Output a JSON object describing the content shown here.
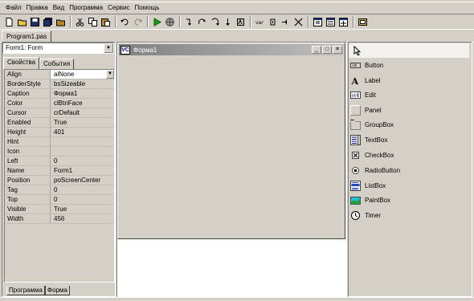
{
  "menu": [
    "Файл",
    "Правка",
    "Вид",
    "Программа",
    "Сервис",
    "Помощь"
  ],
  "toolbar": {
    "icons": [
      "new-file-icon",
      "open-icon",
      "save-icon",
      "save-all-icon",
      "close-file-icon",
      "cut-icon",
      "copy-icon",
      "paste-icon",
      "undo-icon",
      "redo-icon",
      "run-icon",
      "globe-icon",
      "step-into-icon",
      "step-over-icon",
      "step-out-icon",
      "run-to-cursor-icon",
      "reset-icon",
      "watch-icon",
      "breakpoint-icon",
      "stop-icon",
      "clear-icon",
      "window-a-icon",
      "window-b-icon",
      "window-c-icon",
      "form-icon"
    ]
  },
  "editor": {
    "tab_label": "Program1.pas"
  },
  "inspector": {
    "object_select": "Form1: Form",
    "tabs": [
      "Свойства",
      "События"
    ],
    "properties": [
      {
        "name": "Align",
        "value": "alNone"
      },
      {
        "name": "BorderStyle",
        "value": "bsSizeable"
      },
      {
        "name": "Caption",
        "value": "Форма1"
      },
      {
        "name": "Color",
        "value": "clBtnFace"
      },
      {
        "name": "Cursor",
        "value": "crDefault"
      },
      {
        "name": "Enabled",
        "value": "True"
      },
      {
        "name": "Height",
        "value": "401"
      },
      {
        "name": "Hint",
        "value": ""
      },
      {
        "name": "Icon",
        "value": ""
      },
      {
        "name": "Left",
        "value": "0"
      },
      {
        "name": "Name",
        "value": "Form1"
      },
      {
        "name": "Position",
        "value": "poScreenCenter"
      },
      {
        "name": "Tag",
        "value": "0"
      },
      {
        "name": "Top",
        "value": "0"
      },
      {
        "name": "Visible",
        "value": "True"
      },
      {
        "name": "Width",
        "value": "456"
      }
    ],
    "bottom_tabs": [
      "Программа",
      "Форма"
    ]
  },
  "designer": {
    "form_title": "Форма1",
    "icon_text": "VC"
  },
  "palette": {
    "items": [
      {
        "label": "Button",
        "icon": "button-icon"
      },
      {
        "label": "Label",
        "icon": "label-icon"
      },
      {
        "label": "Edit",
        "icon": "edit-icon"
      },
      {
        "label": "Panel",
        "icon": "panel-icon"
      },
      {
        "label": "GroupBox",
        "icon": "groupbox-icon"
      },
      {
        "label": "TextBox",
        "icon": "textbox-icon"
      },
      {
        "label": "CheckBox",
        "icon": "checkbox-icon"
      },
      {
        "label": "RadioButton",
        "icon": "radiobutton-icon"
      },
      {
        "label": "ListBox",
        "icon": "listbox-icon"
      },
      {
        "label": "PaintBox",
        "icon": "paintbox-icon"
      },
      {
        "label": "Timer",
        "icon": "timer-icon"
      }
    ]
  }
}
